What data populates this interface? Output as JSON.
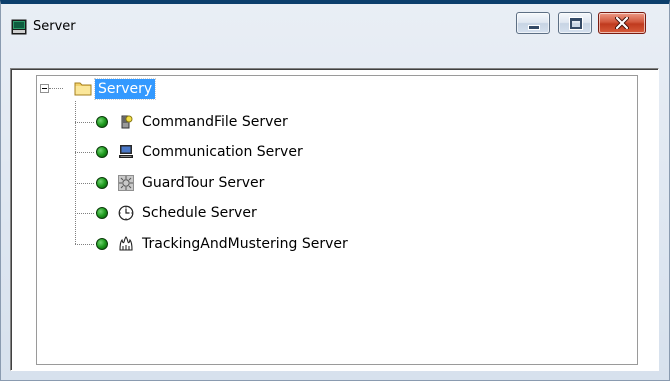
{
  "window": {
    "title": "Server"
  },
  "tree": {
    "root": {
      "label": "Servery",
      "expanded": true,
      "selected": true
    },
    "children": [
      {
        "label": "CommandFile Server",
        "icon": "command-file-icon",
        "status": "online"
      },
      {
        "label": "Communication Server",
        "icon": "computer-icon",
        "status": "online"
      },
      {
        "label": "GuardTour Server",
        "icon": "guard-tour-icon",
        "status": "online"
      },
      {
        "label": "Schedule Server",
        "icon": "clock-icon",
        "status": "online"
      },
      {
        "label": "TrackingAndMustering Server",
        "icon": "mustering-icon",
        "status": "online"
      }
    ]
  },
  "colors": {
    "selection": "#3399ff",
    "status_online": "#1e9a1e",
    "close_button": "#c03a1e"
  }
}
